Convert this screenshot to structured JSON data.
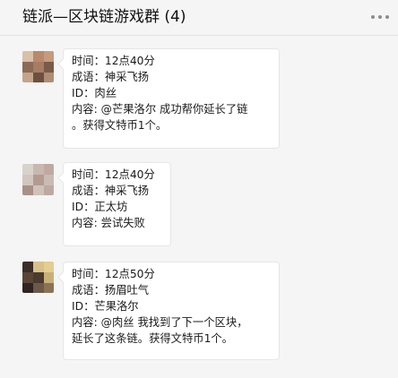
{
  "header": {
    "title": "链派—区块链游戏群 (4)",
    "more_icon": "more-dots-icon"
  },
  "messages": [
    {
      "avatar_colors": [
        "#d9c0a8",
        "#b8896b",
        "#c59b7e",
        "#8c6a55",
        "#a67c62",
        "#7a5a48",
        "#c5a48c",
        "#6e4f3f",
        "#b18c74"
      ],
      "lines": [
        "时间：12点40分",
        "成语：神采飞扬",
        "ID：肉丝",
        "内容: @芒果洛尔 成功帮你延长了链",
        "。获得文特币1个。"
      ]
    },
    {
      "avatar_colors": [
        "#d8d2cc",
        "#c9b8b0",
        "#bfa9a0",
        "#d1c6c0",
        "#b39b92",
        "#c8bbb4",
        "#a89088",
        "#cfc2bb",
        "#bcaaa2"
      ],
      "lines": [
        "时间：12点40分",
        "成语：神采飞扬",
        "ID：正太坊",
        "内容: 尝试失败"
      ]
    },
    {
      "avatar_colors": [
        "#3a2e27",
        "#d7c089",
        "#e3cd8f",
        "#5a4536",
        "#4a3a30",
        "#c9b07a",
        "#2e2520",
        "#6b5a48",
        "#8a7355"
      ],
      "lines": [
        "时间：12点50分",
        "成语：扬眉吐气",
        "ID：芒果洛尔",
        "内容: @肉丝 我找到了下一个区块，",
        "延长了这条链。获得文特币1个。"
      ]
    }
  ]
}
